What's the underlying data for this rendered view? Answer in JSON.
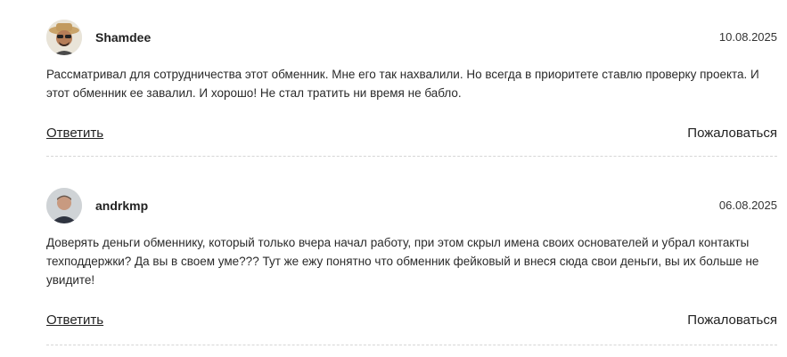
{
  "comments": [
    {
      "author": "Shamdee",
      "date": "10.08.2025",
      "text": "Рассматривал для сотрудничества этот обменник. Мне его так нахвалили. Но всегда в приоритете ставлю проверку проекта. И этот обменник ее завалил. И хорошо! Не стал тратить ни время не бабло.",
      "reply_label": "Ответить",
      "report_label": "Пожаловаться"
    },
    {
      "author": "andrkmp",
      "date": "06.08.2025",
      "text": "Доверять деньги обменнику, который только вчера начал работу, при этом скрыл имена своих основателей и убрал контакты техподдержки? Да вы в своем уме??? Тут же ежу понятно что обменник фейковый и внеся сюда свои деньги, вы их больше не увидите!",
      "reply_label": "Ответить",
      "report_label": "Пожаловаться"
    }
  ]
}
